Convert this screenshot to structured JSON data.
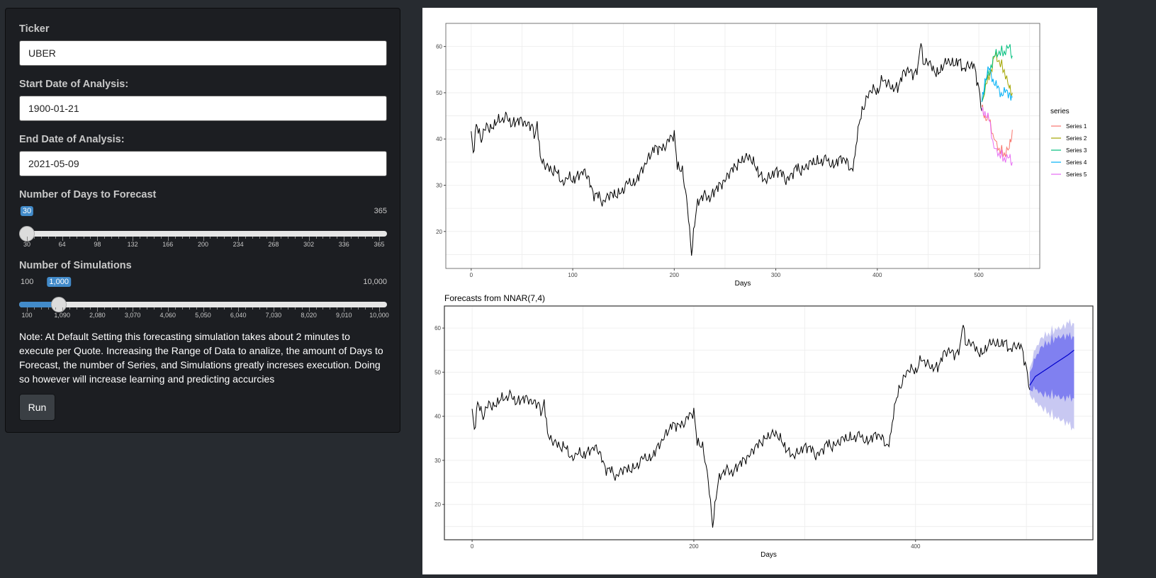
{
  "sidebar": {
    "ticker": {
      "label": "Ticker",
      "value": "UBER"
    },
    "start_date": {
      "label": "Start Date of Analysis:",
      "value": "1900-01-21"
    },
    "end_date": {
      "label": "End Date of Analysis:",
      "value": "2021-05-09"
    },
    "days_slider": {
      "label": "Number of Days to Forecast",
      "min_label": "30",
      "max_label": "365",
      "value_label": "30",
      "value": 30,
      "ticks": [
        "30",
        "64",
        "98",
        "132",
        "166",
        "200",
        "234",
        "268",
        "302",
        "336",
        "365"
      ]
    },
    "sims_slider": {
      "label": "Number of Simulations",
      "min_label": "100",
      "max_label": "10,000",
      "value_label": "1,000",
      "value": 1000,
      "ticks": [
        "100",
        "1,090",
        "2,080",
        "3,070",
        "4,060",
        "5,050",
        "6,040",
        "7,030",
        "8,020",
        "9,010",
        "10,000"
      ]
    },
    "note": "Note: At Default Setting this forecasting simulation takes about 2 minutes to execute per Quote. Increasing the Range of Data to analize, the amount of Days to Forecast, the number of Series, and Simulations greatly increses execution. Doing so however will increase learning and predicting accurcies",
    "run_label": "Run"
  },
  "chart_data": [
    {
      "type": "line",
      "title": "",
      "xlabel": "Days",
      "ylabel": "",
      "xlim": [
        -25,
        560
      ],
      "ylim": [
        12,
        65
      ],
      "x_ticks": [
        "0",
        "100",
        "200",
        "300",
        "400",
        "500"
      ],
      "y_ticks": [
        "20",
        "30",
        "40",
        "50",
        "60"
      ],
      "legend_title": "series",
      "legend_position": "right",
      "grid": true,
      "colors": {
        "history": "#000000",
        "Series 1": "#f8766d",
        "Series 2": "#a3a500",
        "Series 3": "#00bf7d",
        "Series 4": "#00b0f6",
        "Series 5": "#e76bf3"
      },
      "history_anchors": [
        [
          0,
          41
        ],
        [
          2,
          37
        ],
        [
          5,
          43
        ],
        [
          10,
          40
        ],
        [
          15,
          43
        ],
        [
          20,
          42
        ],
        [
          25,
          44
        ],
        [
          30,
          44
        ],
        [
          35,
          45
        ],
        [
          40,
          43
        ],
        [
          45,
          44
        ],
        [
          50,
          44
        ],
        [
          55,
          43
        ],
        [
          60,
          43
        ],
        [
          63,
          40
        ],
        [
          65,
          44
        ],
        [
          68,
          36
        ],
        [
          70,
          35
        ],
        [
          75,
          34
        ],
        [
          80,
          33
        ],
        [
          85,
          33
        ],
        [
          90,
          30
        ],
        [
          95,
          32
        ],
        [
          100,
          31
        ],
        [
          105,
          32
        ],
        [
          110,
          33
        ],
        [
          115,
          32
        ],
        [
          120,
          28
        ],
        [
          125,
          28
        ],
        [
          130,
          26
        ],
        [
          135,
          28
        ],
        [
          140,
          28
        ],
        [
          145,
          28
        ],
        [
          150,
          29
        ],
        [
          155,
          31
        ],
        [
          160,
          30
        ],
        [
          165,
          32
        ],
        [
          170,
          34
        ],
        [
          175,
          36
        ],
        [
          180,
          38
        ],
        [
          185,
          38
        ],
        [
          190,
          38
        ],
        [
          195,
          40
        ],
        [
          200,
          41
        ],
        [
          203,
          34
        ],
        [
          205,
          34
        ],
        [
          208,
          33
        ],
        [
          210,
          30
        ],
        [
          213,
          26
        ],
        [
          215,
          20
        ],
        [
          217,
          15
        ],
        [
          220,
          22
        ],
        [
          222,
          25
        ],
        [
          225,
          27
        ],
        [
          230,
          28
        ],
        [
          235,
          27
        ],
        [
          240,
          29
        ],
        [
          245,
          30
        ],
        [
          250,
          31
        ],
        [
          255,
          33
        ],
        [
          260,
          34
        ],
        [
          265,
          35
        ],
        [
          270,
          36
        ],
        [
          275,
          36
        ],
        [
          280,
          34
        ],
        [
          285,
          32
        ],
        [
          290,
          31
        ],
        [
          295,
          32
        ],
        [
          300,
          33
        ],
        [
          305,
          33
        ],
        [
          310,
          31
        ],
        [
          315,
          32
        ],
        [
          320,
          34
        ],
        [
          325,
          33
        ],
        [
          330,
          34
        ],
        [
          335,
          35
        ],
        [
          340,
          35
        ],
        [
          345,
          35
        ],
        [
          350,
          36
        ],
        [
          355,
          34
        ],
        [
          360,
          35
        ],
        [
          365,
          36
        ],
        [
          370,
          35
        ],
        [
          375,
          33
        ],
        [
          378,
          36
        ],
        [
          380,
          41
        ],
        [
          385,
          46
        ],
        [
          390,
          49
        ],
        [
          395,
          51
        ],
        [
          400,
          50
        ],
        [
          405,
          53
        ],
        [
          410,
          52
        ],
        [
          415,
          51
        ],
        [
          420,
          51
        ],
        [
          425,
          54
        ],
        [
          430,
          55
        ],
        [
          435,
          54
        ],
        [
          440,
          55
        ],
        [
          443,
          62
        ],
        [
          445,
          56
        ],
        [
          450,
          57
        ],
        [
          455,
          55
        ],
        [
          460,
          54
        ],
        [
          465,
          56
        ],
        [
          470,
          57
        ],
        [
          475,
          56
        ],
        [
          480,
          57
        ],
        [
          485,
          55
        ],
        [
          490,
          56
        ],
        [
          495,
          56
        ],
        [
          500,
          51
        ],
        [
          503,
          46
        ]
      ],
      "series": [
        {
          "name": "Series 1",
          "values": [
            [
              503,
              47
            ],
            [
              506,
              45
            ],
            [
              510,
              44
            ],
            [
              515,
              40
            ],
            [
              520,
              38
            ],
            [
              525,
              37
            ],
            [
              530,
              38
            ],
            [
              533,
              42
            ]
          ]
        },
        {
          "name": "Series 2",
          "values": [
            [
              503,
              48
            ],
            [
              508,
              52
            ],
            [
              512,
              55
            ],
            [
              516,
              58
            ],
            [
              520,
              57
            ],
            [
              525,
              55
            ],
            [
              530,
              51
            ],
            [
              533,
              50
            ]
          ]
        },
        {
          "name": "Series 3",
          "values": [
            [
              503,
              48
            ],
            [
              508,
              53
            ],
            [
              512,
              56
            ],
            [
              516,
              58
            ],
            [
              520,
              59
            ],
            [
              525,
              59
            ],
            [
              530,
              60
            ],
            [
              533,
              58
            ]
          ]
        },
        {
          "name": "Series 4",
          "values": [
            [
              503,
              48
            ],
            [
              506,
              53
            ],
            [
              510,
              55
            ],
            [
              514,
              53
            ],
            [
              518,
              51
            ],
            [
              522,
              50
            ],
            [
              526,
              50
            ],
            [
              530,
              50
            ],
            [
              533,
              49
            ]
          ]
        },
        {
          "name": "Series 5",
          "values": [
            [
              503,
              46
            ],
            [
              506,
              46
            ],
            [
              510,
              44
            ],
            [
              515,
              38
            ],
            [
              520,
              37
            ],
            [
              525,
              36
            ],
            [
              530,
              36
            ],
            [
              533,
              35
            ]
          ]
        }
      ]
    },
    {
      "type": "line",
      "title": "Forecasts from NNAR(7,4)",
      "xlabel": "Days",
      "ylabel": "",
      "xlim": [
        -25,
        560
      ],
      "ylim": [
        12,
        65
      ],
      "x_ticks": [
        "0",
        "200",
        "400"
      ],
      "y_ticks": [
        "20",
        "30",
        "40",
        "50",
        "60"
      ],
      "grid": true,
      "colors": {
        "history": "#000000",
        "forecast": "#0000cc",
        "pi80": "#8080f0",
        "pi95": "#c8c8f2"
      },
      "forecast": [
        [
          503,
          47
        ],
        [
          508,
          49
        ],
        [
          514,
          50
        ],
        [
          520,
          51
        ],
        [
          526,
          52
        ],
        [
          532,
          53
        ],
        [
          538,
          54
        ],
        [
          543,
          55
        ]
      ],
      "pi80_upper": [
        [
          503,
          50
        ],
        [
          508,
          53
        ],
        [
          514,
          56
        ],
        [
          520,
          57
        ],
        [
          526,
          58
        ],
        [
          532,
          58
        ],
        [
          538,
          58
        ],
        [
          543,
          58
        ]
      ],
      "pi80_lower": [
        [
          503,
          46
        ],
        [
          508,
          46
        ],
        [
          514,
          45
        ],
        [
          520,
          45
        ],
        [
          526,
          45
        ],
        [
          532,
          44
        ],
        [
          538,
          44
        ],
        [
          543,
          44
        ]
      ],
      "pi95_upper": [
        [
          503,
          51
        ],
        [
          508,
          55
        ],
        [
          514,
          58
        ],
        [
          520,
          59
        ],
        [
          526,
          60
        ],
        [
          532,
          60
        ],
        [
          538,
          61
        ],
        [
          543,
          61
        ]
      ],
      "pi95_lower": [
        [
          503,
          45
        ],
        [
          508,
          43
        ],
        [
          514,
          42
        ],
        [
          520,
          41
        ],
        [
          526,
          40
        ],
        [
          532,
          39
        ],
        [
          538,
          38
        ],
        [
          543,
          37
        ]
      ]
    }
  ]
}
